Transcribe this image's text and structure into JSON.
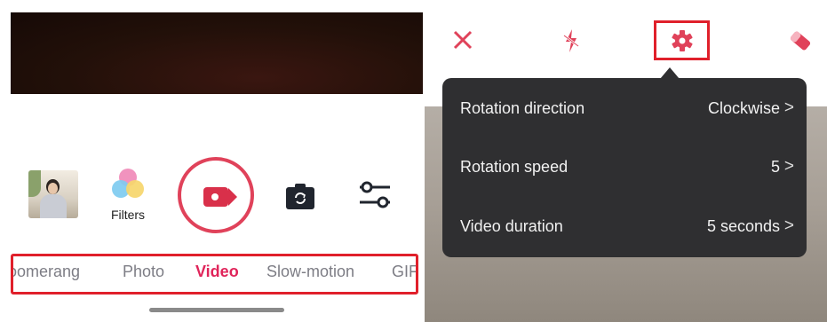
{
  "left_panel": {
    "filters_label": "Filters",
    "modes": [
      "oomerang",
      "Photo",
      "Video",
      "Slow-motion",
      "GIF"
    ],
    "active_mode": "Video",
    "icons": {
      "gallery": "gallery-thumbnail",
      "filters": "filters-icon",
      "record": "video-record-icon",
      "flip": "camera-flip-icon",
      "settings": "sliders-icon"
    }
  },
  "right_panel": {
    "toolbar_icons": [
      "close-icon",
      "flash-off-icon",
      "gear-icon",
      "eraser-icon"
    ],
    "settings_popup": {
      "rows": [
        {
          "label": "Rotation direction",
          "value": "Clockwise"
        },
        {
          "label": "Rotation speed",
          "value": "5"
        },
        {
          "label": "Video duration",
          "value": "5 seconds"
        }
      ],
      "chevron": ">"
    }
  },
  "colors": {
    "accent_red": "#e0425a",
    "highlight_box": "#e0202b",
    "active_mode": "#e0245a",
    "popup_bg": "#2f2f31"
  }
}
